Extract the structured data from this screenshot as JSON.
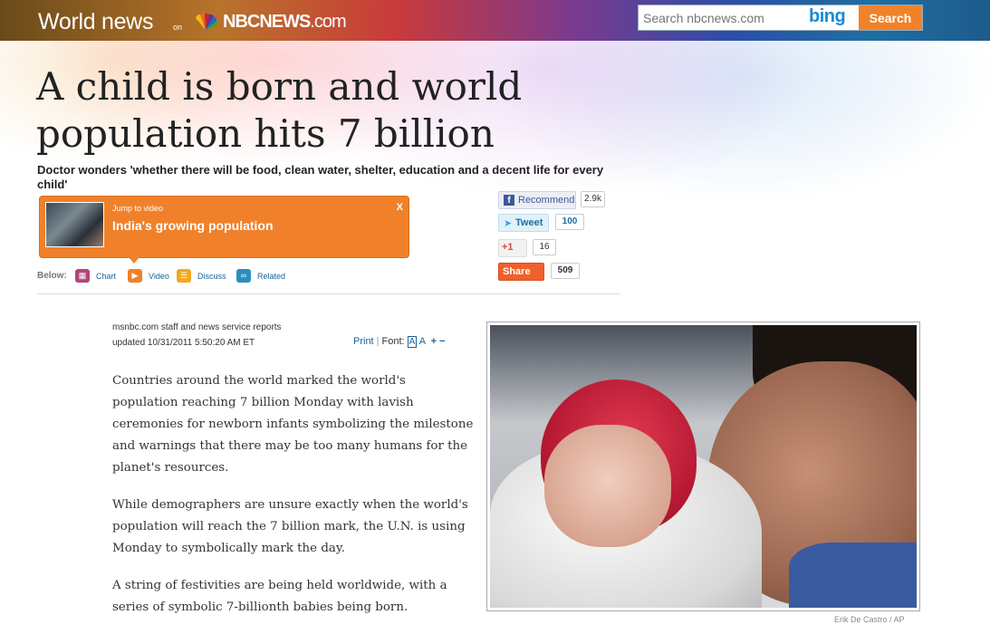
{
  "header": {
    "section": "World news",
    "on": "on",
    "brand": "NBCNEWS",
    "brand_suffix": ".com",
    "search_placeholder": "Search nbcnews.com",
    "search_provider": "bing",
    "search_button": "Search"
  },
  "article": {
    "headline": "A child is born and world population hits 7 billion",
    "deck": "Doctor wonders 'whether there will be food, clean water, shelter, education and a decent life for every child'",
    "byline": "msnbc.com staff and news service reports",
    "updated": "updated 10/31/2011 5:50:20 AM ET",
    "paragraphs": [
      "Countries around the world marked the world's population reaching 7 billion Monday with lavish ceremonies for newborn infants symbolizing the milestone and warnings that there may be too many humans for the planet's resources.",
      "While demographers are unsure exactly when the world's population will reach the 7 billion mark, the U.N. is using Monday to symbolically mark the day.",
      "A string of festivities are being held worldwide, with a series of symbolic 7-billionth babies being born."
    ],
    "photo_credit": "Erik De Castro  /  AP"
  },
  "promo": {
    "jump_label": "Jump to video",
    "title": "India's growing population",
    "close": "X"
  },
  "below": {
    "label": "Below:",
    "items": [
      {
        "label": "Chart",
        "color": "#b0457a",
        "icon": "chart-icon"
      },
      {
        "label": "Video",
        "color": "#f0812a",
        "icon": "video-icon"
      },
      {
        "label": "Discuss",
        "color": "#f0a820",
        "icon": "discuss-icon"
      },
      {
        "label": "Related",
        "color": "#2a8fc0",
        "icon": "related-icon"
      }
    ]
  },
  "social": {
    "facebook_label": "Recommend",
    "facebook_count": "2.9k",
    "twitter_label": "Tweet",
    "twitter_count": "100",
    "gplus_label": "+1",
    "gplus_count": "16",
    "share_label": "Share",
    "share_count": "509"
  },
  "tools": {
    "print": "Print",
    "font": "Font:",
    "font_a_small": "A",
    "font_a": "A",
    "increase": "+",
    "decrease": "−"
  }
}
